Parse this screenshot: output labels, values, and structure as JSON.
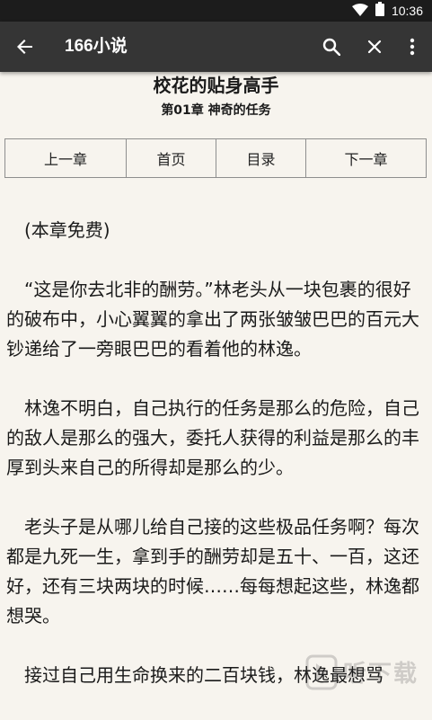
{
  "status_bar": {
    "time": "10:36"
  },
  "app_bar": {
    "title": "166小说"
  },
  "book": {
    "title": "校花的贴身高手",
    "chapter": "第01章 神奇的任务"
  },
  "nav": {
    "prev": "上一章",
    "home": "首页",
    "toc": "目录",
    "next": "下一章"
  },
  "content": {
    "paragraphs": [
      "(本章免费)",
      "“这是你去北非的酬劳。”林老头从一块包裹的很好的破布中，小心翼翼的拿出了两张皱皱巴巴的百元大钞递给了一旁眼巴巴的看着他的林逸。",
      "林逸不明白，自己执行的任务是那么的危险，自己的敌人是那么的强大，委托人获得的利益是那么的丰厚到头来自己的所得却是那么的少。",
      "老头子是从哪儿给自己接的这些极品任务啊？每次都是九死一生，拿到手的酬劳却是五十、一百，这还好，还有三块两块的时候……每每想起这些，林逸都想哭。",
      "接过自己用生命换来的二百块钱，林逸最想骂"
    ]
  },
  "watermark": {
    "text": "听下载"
  }
}
